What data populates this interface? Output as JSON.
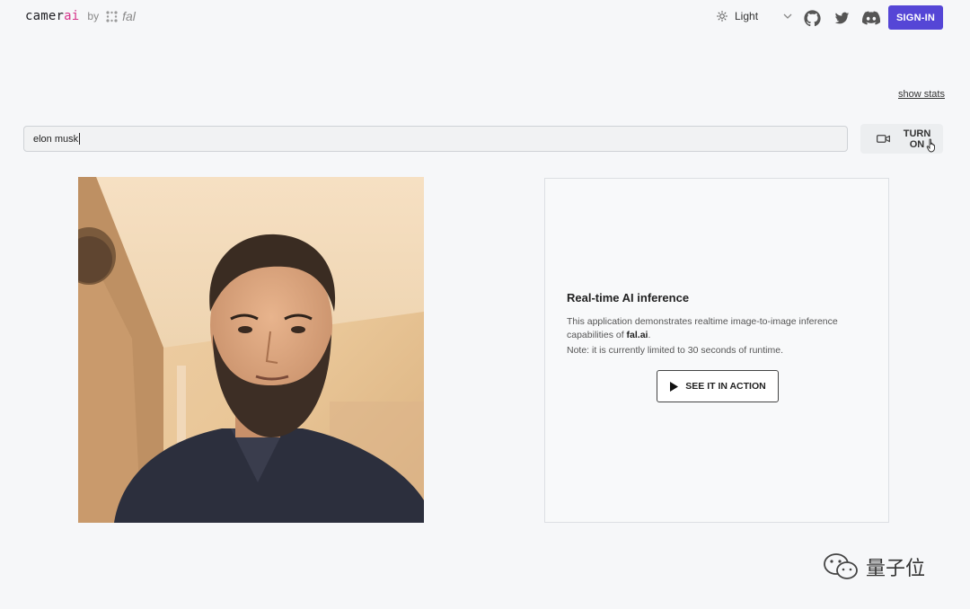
{
  "header": {
    "brand_prefix": "camer",
    "brand_accent": "ai",
    "brand_by": "by",
    "partner": "fal",
    "theme_label": "Light",
    "signin_label": "SIGN-IN",
    "icons": [
      "github-icon",
      "twitter-icon",
      "discord-icon",
      "sun-icon",
      "chevron-down-icon"
    ]
  },
  "stats_link": "show stats",
  "prompt": {
    "value": "elon musk"
  },
  "camera_button": {
    "label": "TURN ON",
    "icon": "video-camera-icon"
  },
  "info": {
    "title": "Real-time AI inference",
    "desc_prefix": "This application demonstrates realtime image-to-image inference capabilities of",
    "desc_link": "fal.ai",
    "desc_suffix": ".",
    "note": "Note: it is currently limited to 30 seconds of runtime.",
    "action_label": "SEE IT IN ACTION"
  },
  "watermark": {
    "text": "量子位"
  },
  "colors": {
    "primary": "#5546d6",
    "brand_accent": "#d6338a",
    "background": "#f6f7f9"
  }
}
